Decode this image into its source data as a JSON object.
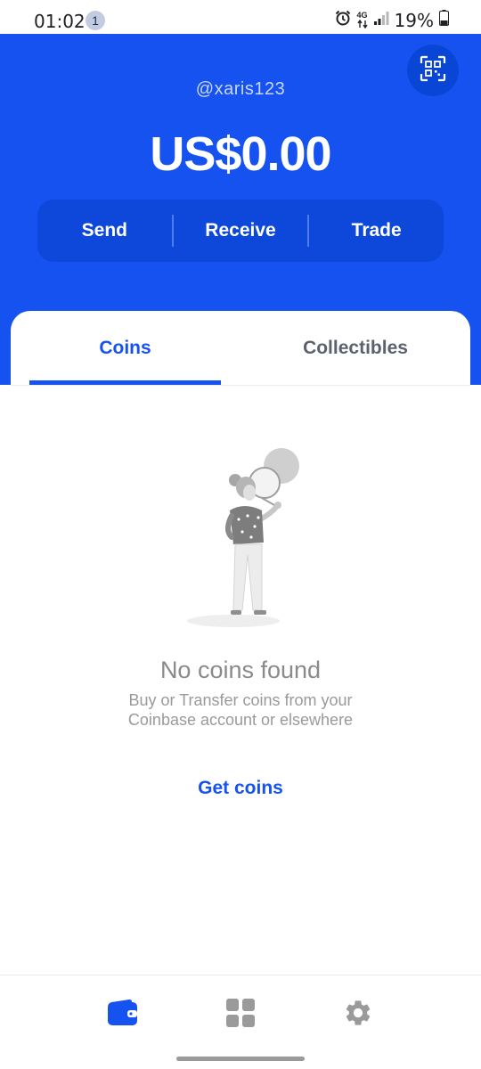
{
  "status_bar": {
    "time": "01:02",
    "notification_count": "1",
    "network": "4G",
    "battery_percent": "19%"
  },
  "header": {
    "username": "@xaris123",
    "balance": "US$0.00",
    "actions": {
      "send": "Send",
      "receive": "Receive",
      "trade": "Trade"
    },
    "qr_icon": "qr-scan-icon"
  },
  "tabs": {
    "coins": "Coins",
    "collectibles": "Collectibles",
    "active": "Coins"
  },
  "empty_state": {
    "title": "No coins found",
    "subtitle": "Buy or Transfer coins from your Coinbase account or elsewhere",
    "cta": "Get coins"
  },
  "bottom_nav": {
    "items": [
      "wallet-icon",
      "apps-grid-icon",
      "settings-gear-icon"
    ],
    "active": "wallet-icon"
  },
  "colors": {
    "brand_blue": "#1652f0",
    "action_bar": "#0d48db",
    "muted_text": "#8a8a8a"
  }
}
